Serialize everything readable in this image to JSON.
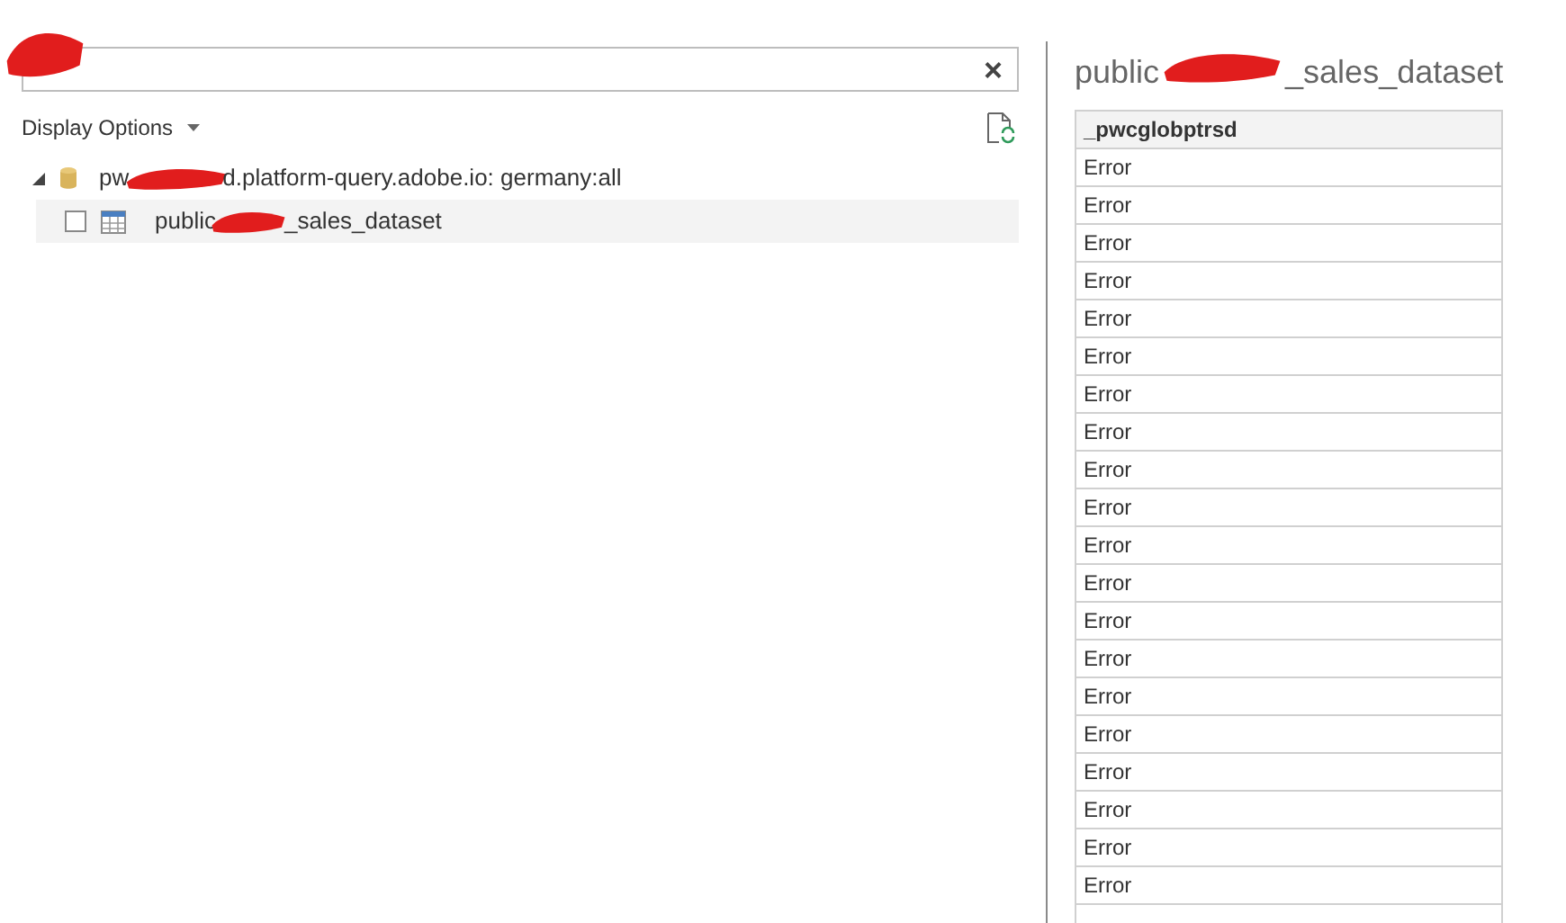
{
  "search": {
    "clear_label": "×"
  },
  "display_options": {
    "label": "Display Options"
  },
  "tree": [
    {
      "kind": "database",
      "label_start": "pw",
      "label_end": "d.platform-query.adobe.io: germany:all",
      "expanded": true,
      "children": [
        {
          "kind": "table",
          "label_start": "public",
          "label_end": "_sales_dataset",
          "checked": false,
          "selected": true
        }
      ]
    }
  ],
  "preview": {
    "title_start": "public",
    "title_end": "_sales_dataset",
    "columns": [
      "_pwcglobptrsd"
    ],
    "rows": [
      "Error",
      "Error",
      "Error",
      "Error",
      "Error",
      "Error",
      "Error",
      "Error",
      "Error",
      "Error",
      "Error",
      "Error",
      "Error",
      "Error",
      "Error",
      "Error",
      "Error",
      "Error",
      "Error",
      "Error"
    ]
  }
}
